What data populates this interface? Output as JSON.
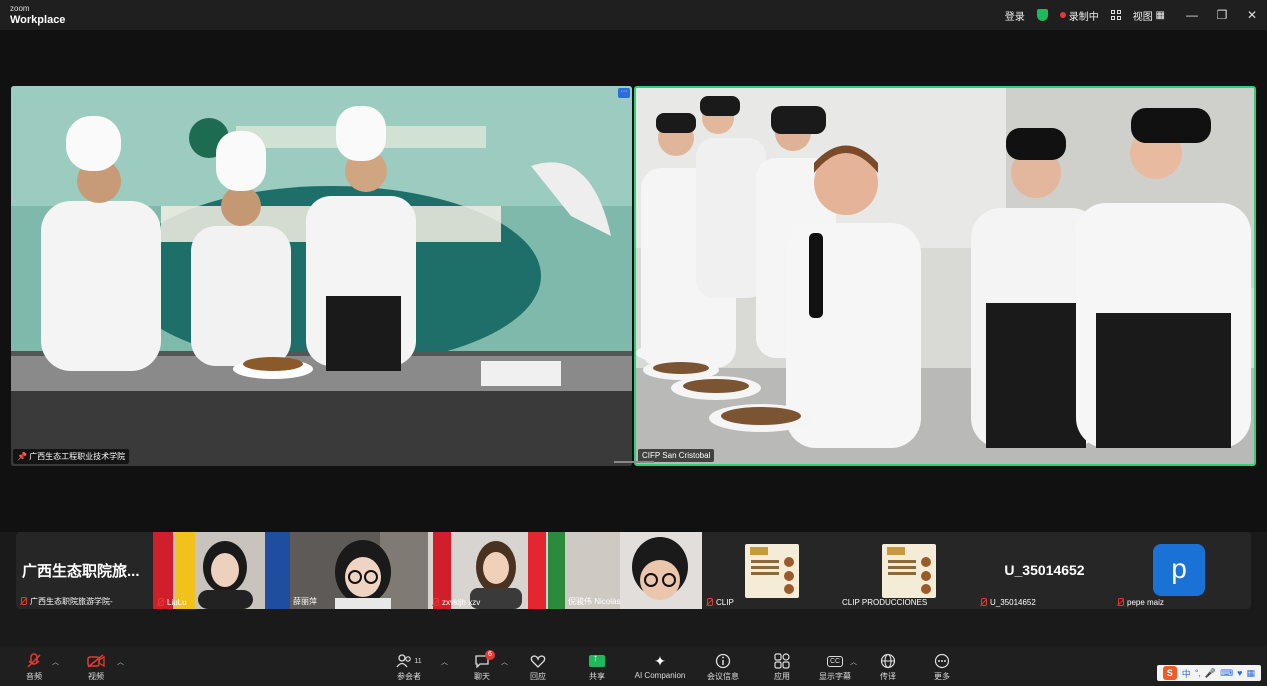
{
  "app": {
    "logo_small": "zoom",
    "logo_big": "Workplace"
  },
  "titlebar": {
    "signin": "登录",
    "recording": "录制中",
    "view": "视图"
  },
  "stage": {
    "videos": [
      {
        "name": "广西生态工程职业技术学院"
      },
      {
        "name": "CIFP San Cristobal"
      }
    ]
  },
  "gallery": [
    {
      "name": "广西生态职院旅游学院-",
      "display": "广西生态职院旅...",
      "muted": true
    },
    {
      "name": "LiuLu",
      "muted": true
    },
    {
      "name": "薛丽萍",
      "muted": false
    },
    {
      "name": "zxvkljh xzv",
      "muted": true
    },
    {
      "name": "倪骏伟 Nicolás",
      "muted": false
    },
    {
      "name": "CLIP",
      "muted": true
    },
    {
      "name": "CLIP PRODUCCIONES",
      "muted": false
    },
    {
      "name": "U_35014652",
      "display": "U_35014652",
      "muted": true
    },
    {
      "name": "pepe maiz",
      "avatar": "p",
      "muted": true
    }
  ],
  "toolbar": {
    "audio": "音频",
    "video": "视频",
    "participants": "参会者",
    "participants_count": "11",
    "chat": "聊天",
    "chat_badge": "6",
    "react": "回应",
    "share": "共享",
    "ai": "AI Companion",
    "info": "会议信息",
    "apps": "应用",
    "captions": "显示字幕",
    "translate": "传译",
    "more": "更多"
  },
  "ime": {
    "label": "中"
  },
  "colors": {
    "active_border": "#2fd07a",
    "muted": "#e53935",
    "share": "#1fb85c",
    "avatar": "#1a72d6"
  }
}
